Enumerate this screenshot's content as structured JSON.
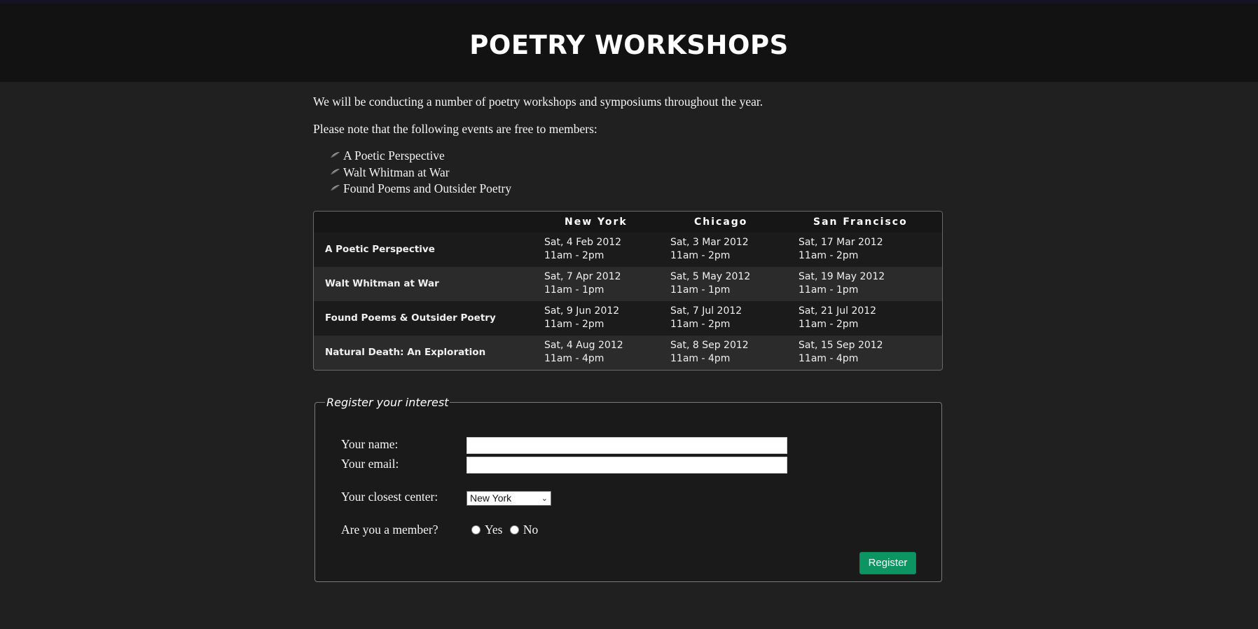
{
  "header": {
    "title": "POETRY WORKSHOPS"
  },
  "intro": {
    "line1": "We will be conducting a number of poetry workshops and symposiums throughout the year.",
    "line2": "Please note that the following events are free to members:"
  },
  "free_events": [
    "A Poetic Perspective",
    "Walt Whitman at War",
    "Found Poems and Outsider Poetry"
  ],
  "schedule": {
    "columns": [
      "",
      "New York",
      "Chicago",
      "San Francisco"
    ],
    "rows": [
      {
        "event": "A Poetic Perspective",
        "ny": {
          "date": "Sat, 4 Feb 2012",
          "time": "11am - 2pm"
        },
        "chi": {
          "date": "Sat, 3 Mar 2012",
          "time": "11am - 2pm"
        },
        "sf": {
          "date": "Sat, 17 Mar 2012",
          "time": "11am - 2pm"
        }
      },
      {
        "event": "Walt Whitman at War",
        "ny": {
          "date": "Sat, 7 Apr 2012",
          "time": "11am - 1pm"
        },
        "chi": {
          "date": "Sat, 5 May 2012",
          "time": "11am - 1pm"
        },
        "sf": {
          "date": "Sat, 19 May 2012",
          "time": "11am - 1pm"
        }
      },
      {
        "event": "Found Poems & Outsider Poetry",
        "ny": {
          "date": "Sat, 9 Jun 2012",
          "time": "11am - 2pm"
        },
        "chi": {
          "date": "Sat, 7 Jul 2012",
          "time": "11am - 2pm"
        },
        "sf": {
          "date": "Sat, 21 Jul 2012",
          "time": "11am - 2pm"
        }
      },
      {
        "event": "Natural Death: An Exploration",
        "ny": {
          "date": "Sat, 4 Aug 2012",
          "time": "11am - 4pm"
        },
        "chi": {
          "date": "Sat, 8 Sep 2012",
          "time": "11am - 4pm"
        },
        "sf": {
          "date": "Sat, 15 Sep 2012",
          "time": "11am - 4pm"
        }
      }
    ]
  },
  "form": {
    "legend": "Register your interest",
    "name_label": "Your name:",
    "name_value": "",
    "email_label": "Your email:",
    "email_value": "",
    "center_label": "Your closest center:",
    "center_selected": "New York",
    "member_label": "Are you a member?",
    "member_yes": "Yes",
    "member_no": "No",
    "submit_label": "Register"
  },
  "colors": {
    "page_bg": "#202020",
    "header_bg": "#121212",
    "button_green": "#0c9463"
  }
}
